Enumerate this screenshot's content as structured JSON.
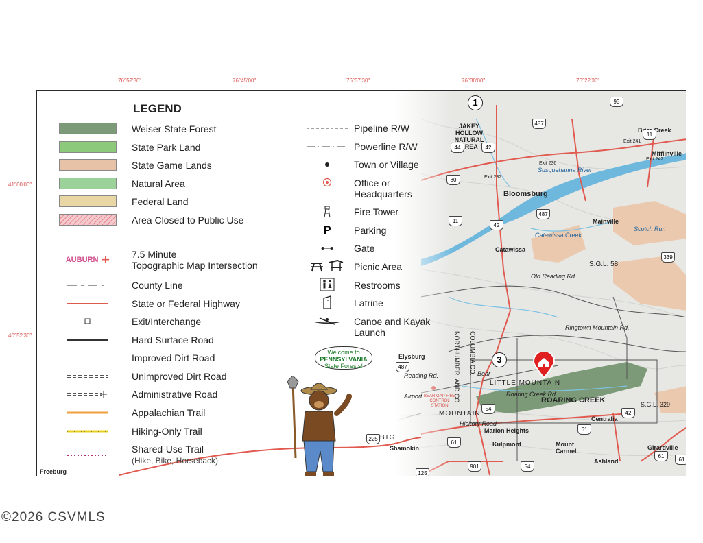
{
  "coords_top": [
    "76°52'30\"",
    "76°45'00\"",
    "76°37'30\"",
    "76°30'00\"",
    "76°22'30\""
  ],
  "coords_left": [
    "41°00'00\"",
    "40°52'30\""
  ],
  "legend": {
    "title": "LEGEND",
    "areas": [
      {
        "label": "Weiser State Forest",
        "color": "#7c9a78"
      },
      {
        "label": "State Park Land",
        "color": "#8cc97a"
      },
      {
        "label": "State Game Lands",
        "color": "#e8c2a6"
      },
      {
        "label": "Natural Area",
        "color": "#9bd29a"
      },
      {
        "label": "Federal Land",
        "color": "#e8d7a4"
      },
      {
        "label": "Area Closed to Public Use",
        "color": "#f4c9cc"
      }
    ],
    "topo": {
      "sample": "AUBURN",
      "label": "7.5 Minute",
      "label2": "Topographic Map Intersection"
    },
    "lines": [
      {
        "label": "County Line"
      },
      {
        "label": "State or Federal Highway"
      },
      {
        "label": "Exit/Interchange"
      },
      {
        "label": "Hard Surface Road"
      },
      {
        "label": "Improved Dirt Road"
      },
      {
        "label": "Unimproved Dirt Road"
      },
      {
        "label": "Administrative Road"
      },
      {
        "label": "Appalachian Trail"
      },
      {
        "label": "Hiking-Only Trail"
      },
      {
        "label": "Shared-Use Trail",
        "sub": "(Hike, Bike, Horseback)"
      }
    ],
    "right": [
      {
        "label": "Pipeline R/W"
      },
      {
        "label": "Powerline R/W"
      },
      {
        "label": "Town or Village"
      },
      {
        "label": "Office or",
        "label2": "Headquarters"
      },
      {
        "label": "Fire Tower"
      },
      {
        "label": "Parking",
        "symbol": "P"
      },
      {
        "label": "Gate"
      },
      {
        "label": "Picnic Area"
      },
      {
        "label": "Restrooms"
      },
      {
        "label": "Latrine"
      },
      {
        "label": "Canoe and Kayak",
        "label2": "Launch"
      }
    ]
  },
  "welcome": {
    "line1": "Welcome to",
    "line2": "PENNSYLVANIA",
    "line3": "State Forests!"
  },
  "markers": {
    "one": "1",
    "three": "3"
  },
  "places": {
    "jakey_hollow": "JAKEY HOLLOW NATURAL AREA",
    "briar_creek": "Briar Creek",
    "mifflinville": "Mifflinville",
    "exit241": "Exit 241",
    "exit236": "Exit 236",
    "exit232": "Exit 232",
    "exit242": "Exit 242",
    "bloomsburg": "Bloomsburg",
    "susquehanna": "Susquehanna River",
    "mainville": "Mainville",
    "catawissa": "Catawissa",
    "sgl58": "S.G.L. 58",
    "old_reading": "Old Reading Rd.",
    "ringtown": "Ringtown Mountain Rd.",
    "elysburg": "Elysburg",
    "northumberland": "NORTHUMBERLAND CO.",
    "columbia": "COLUMBIA CO.",
    "little_mountain": "LITTLE MOUNTAIN",
    "roaring_creek": "ROARING CREEK",
    "mountain": "MOUNTAIN",
    "bear_gap": "BEAR GAP FIRE CONTROL STATION",
    "marion_heights": "Marion Heights",
    "kulpmont": "Kulpmont",
    "shamokin": "Shamokin",
    "mount_carmel": "Mount Carmel",
    "centralia": "Centralia",
    "ashland": "Ashland",
    "girardville": "Girardville",
    "sgl329": "S.G.L. 329",
    "big": "BIG",
    "freeburg": "Freeburg",
    "hickory": "Hickory Road",
    "scotch_run": "Scotch Run",
    "catawissa_creek": "Catawissa Creek",
    "roaring_creek_rd": "Roaring Creek Rd.",
    "bear": "Bear",
    "airport": "Airport",
    "reading_rd": "Reading Rd."
  },
  "highways": [
    "93",
    "487",
    "11",
    "44",
    "42",
    "80",
    "11",
    "487",
    "42",
    "339",
    "487",
    "54",
    "42",
    "61",
    "225",
    "61",
    "901",
    "54",
    "61",
    "61",
    "125"
  ],
  "copyright": "©2026 CSVMLS"
}
